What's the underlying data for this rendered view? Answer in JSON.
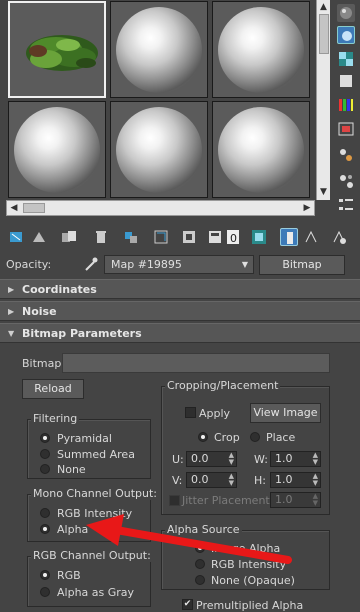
{
  "material_slots": {
    "selected_index": 0,
    "slots": [
      {
        "type": "moss-thumbnail"
      },
      {
        "type": "sphere"
      },
      {
        "type": "sphere"
      },
      {
        "type": "sphere"
      },
      {
        "type": "sphere"
      },
      {
        "type": "sphere"
      }
    ]
  },
  "opacity": {
    "label": "Opacity:",
    "map_name": "Map #19895",
    "map_type_button": "Bitmap"
  },
  "rollouts": {
    "coordinates": "Coordinates",
    "noise": "Noise",
    "bitmap_parameters": "Bitmap Parameters"
  },
  "bitmap_params": {
    "bitmap_label": "Bitmap:",
    "reload_button": "Reload",
    "filtering": {
      "title": "Filtering",
      "options": [
        "Pyramidal",
        "Summed Area",
        "None"
      ],
      "selected": "Pyramidal"
    },
    "mono_channel": {
      "title": "Mono Channel Output:",
      "options": [
        "RGB Intensity",
        "Alpha"
      ],
      "selected": "Alpha"
    },
    "rgb_channel": {
      "title": "RGB Channel Output:",
      "options": [
        "RGB",
        "Alpha as Gray"
      ],
      "selected": "RGB"
    },
    "cropping": {
      "title": "Cropping/Placement",
      "apply_label": "Apply",
      "view_image_button": "View Image",
      "crop_label": "Crop",
      "place_label": "Place",
      "mode": "Crop",
      "u_label": "U:",
      "u_value": "0.0",
      "v_label": "V:",
      "v_value": "0.0",
      "w_label": "W:",
      "w_value": "1.0",
      "h_label": "H:",
      "h_value": "1.0",
      "jitter_label": "Jitter Placement:",
      "jitter_value": "1.0"
    },
    "alpha_source": {
      "title": "Alpha Source",
      "options": [
        "Image Alpha",
        "RGB Intensity",
        "None (Opaque)"
      ],
      "selected": "Image Alpha",
      "premultiplied_label": "Premultiplied Alpha"
    }
  },
  "annotation": {
    "color": "#e81818"
  }
}
